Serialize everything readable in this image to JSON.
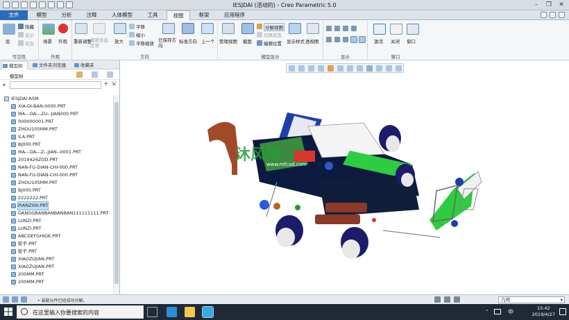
{
  "window": {
    "title": "IESJDAI (活动的) - Creo Parametric 5.0"
  },
  "tabs": [
    "文件",
    "模型",
    "分析",
    "注释",
    "人体模型",
    "工具",
    "视图",
    "框架",
    "应用程序"
  ],
  "ribbon": {
    "visibility": {
      "label": "可见性",
      "hide": "隐藏",
      "show": "显示",
      "status": "状态",
      "layer": "层"
    },
    "appearance": {
      "label": "外观",
      "scene": "场景",
      "appearance": "外观"
    },
    "orientation": {
      "label": "方向",
      "refit": "重新调整",
      "zoom_to_selected": "缩放至选定项",
      "zoom_in": "放大",
      "pan": "平移",
      "zoom_out": "缩小",
      "pan_zoom": "平移缩放",
      "saved_orientations": "已保存方向",
      "standard_orientation": "标准方向",
      "previous": "上一个"
    },
    "model_display": {
      "label": "模型显示",
      "manage_views": "管理视图",
      "section": "截面",
      "explode_view": "分解视图",
      "toggle_status": "切换状态",
      "edit_position": "编辑位置",
      "display_style": "显示样式",
      "perspective": "透视图"
    },
    "show": {
      "label": "显示"
    },
    "window": {
      "label": "窗口",
      "activate": "激活",
      "close": "关闭",
      "windows": "窗口"
    }
  },
  "left_panel": {
    "tabs": [
      "模型树",
      "文件夹浏览器",
      "收藏夹"
    ],
    "header": "模型树",
    "filter_placeholder": "",
    "root": "IESJDAI.ASM",
    "items": [
      "XIA-DI-BAN-0000.PRT",
      "MA---DA---ZU--JIAN000.PRT",
      "000000001.PRT",
      "ZHOU105MM.PRT",
      "ILA.PRT",
      "BJ000.PRT",
      "MA---DA---Z--JIAN--0001.PRT",
      "2019426ZOD.PRT",
      "NAN-FU-DIAN-CHI-000.PRT",
      "NAN-FU-DIAN-CHI-000.PRT",
      "ZHOU105MM.PRT",
      "BJ000.PRT",
      "2222222.PRT",
      "PIANZIIIII.PRT",
      "DANGGBANBANBANBAN111111111.PRT",
      "LUNZI.PRT",
      "LUNZI.PRT",
      "ABCDEFGHIGK.PRT",
      "轮子.PRT",
      "轮子.PRT",
      "XIAOZUJIAN.PRT",
      "XIAOZUJIAN.PRT",
      "200MM.PRT",
      "200MM.PRT"
    ],
    "selected_index": 13
  },
  "viewport": {
    "watermark": "沐风网",
    "watermark_url": "www.mfcad.com"
  },
  "status": {
    "message": "• 装配元件已经成功分解。",
    "filter_value": "几何"
  },
  "taskbar": {
    "search_placeholder": "在这里输入你要搜索的内容",
    "lang": "中",
    "time": "15:42",
    "date": "2019/4/27"
  }
}
